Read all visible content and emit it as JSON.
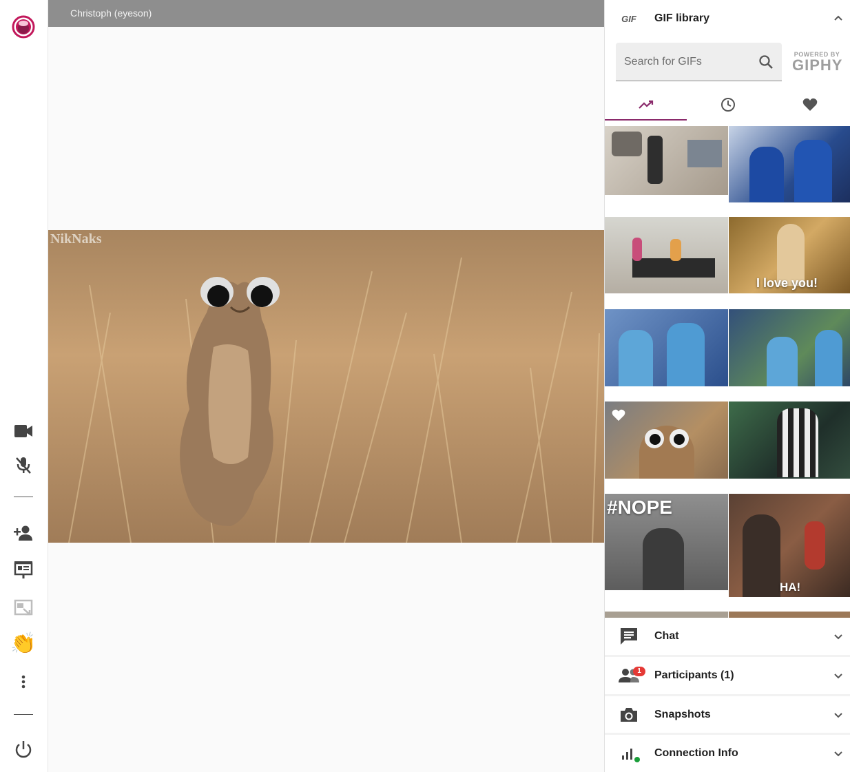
{
  "stage": {
    "participant_name": "Christoph (eyeson)",
    "video_watermark": "NikNaks"
  },
  "rail": {
    "buttons": [
      {
        "name": "camera-icon"
      },
      {
        "name": "mic-off-icon"
      },
      {
        "name": "add-person-icon"
      },
      {
        "name": "presentation-icon"
      },
      {
        "name": "screen-share-icon"
      },
      {
        "name": "wave-hand-icon"
      },
      {
        "name": "more-vert-icon"
      },
      {
        "name": "power-icon"
      }
    ],
    "wave_glyph": "👏"
  },
  "gif_library": {
    "title": "GIF library",
    "badge_text": "GIF",
    "search_placeholder": "Search for GIFs",
    "powered_by": "POWERED BY",
    "giphy": "GIPHY",
    "tabs": [
      {
        "name": "trending",
        "active": true
      },
      {
        "name": "recent",
        "active": false
      },
      {
        "name": "favorites",
        "active": false
      }
    ],
    "gifs": [
      {
        "caption": ""
      },
      {
        "caption": ""
      },
      {
        "caption": ""
      },
      {
        "caption": "I love you!"
      },
      {
        "caption": ""
      },
      {
        "caption": ""
      },
      {
        "caption": "",
        "favorite": true
      },
      {
        "caption": ""
      },
      {
        "caption": "#NOPE"
      },
      {
        "caption": "HA!"
      }
    ]
  },
  "sections": [
    {
      "title": "Chat",
      "icon": "chat-icon"
    },
    {
      "title": "Participants (1)",
      "icon": "people-icon",
      "badge": "1"
    },
    {
      "title": "Snapshots",
      "icon": "camera-icon"
    },
    {
      "title": "Connection Info",
      "icon": "signal-icon"
    }
  ],
  "colors": {
    "accent": "#8a2a6b",
    "brand": "#c2185b",
    "badge": "#e53935",
    "status_ok": "#1a9e3a"
  }
}
